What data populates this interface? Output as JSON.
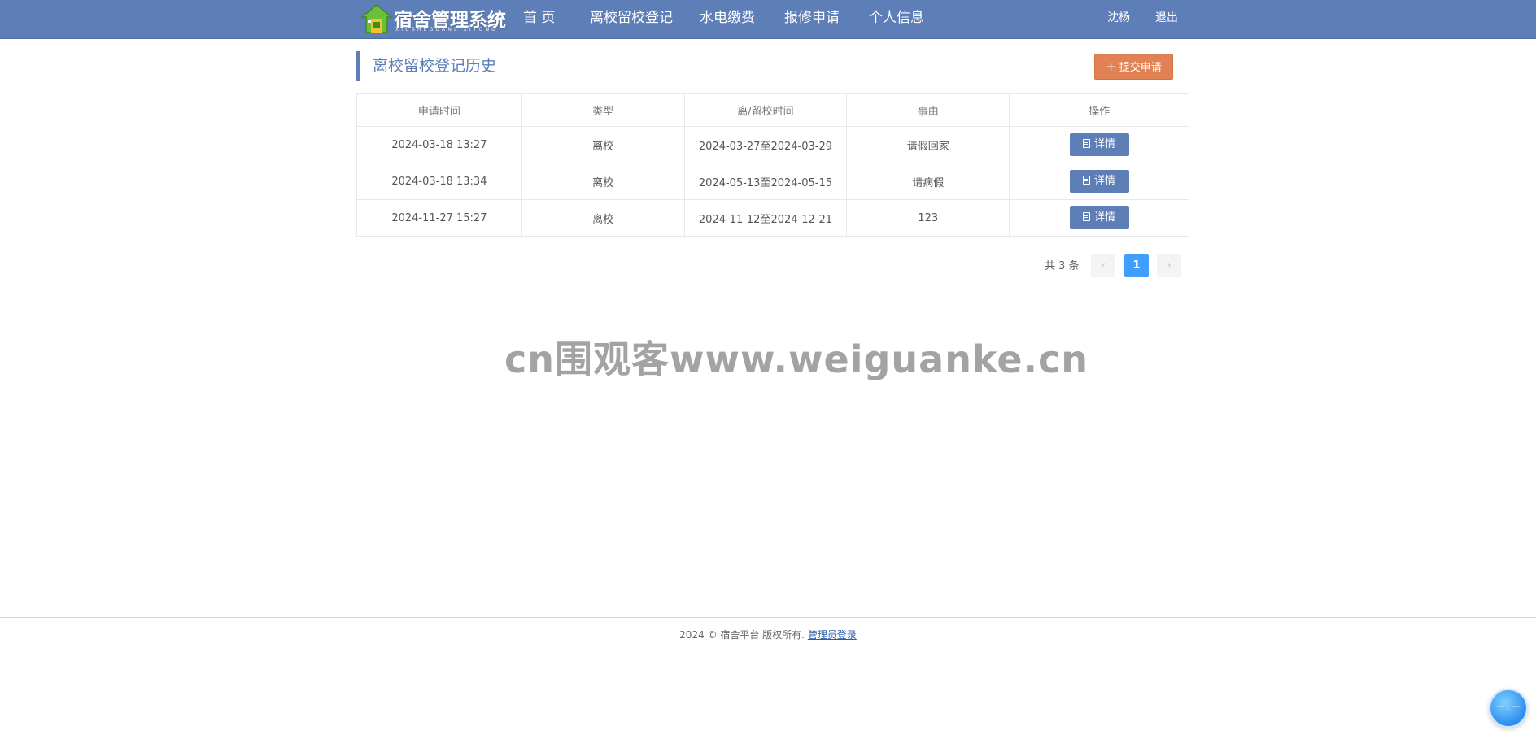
{
  "app": {
    "logo_title": "宿舍管理系统",
    "logo_subtitle": "XIUSHEGUANLIXITONG"
  },
  "nav": {
    "items": [
      {
        "label": "首 页"
      },
      {
        "label": "离校留校登记"
      },
      {
        "label": "水电缴费"
      },
      {
        "label": "报修申请"
      },
      {
        "label": "个人信息"
      }
    ],
    "user_name": "沈杨",
    "logout_label": "退出"
  },
  "page": {
    "title": "离校留校登记历史",
    "submit_label": "提交申请",
    "submit_icon": "plus-icon"
  },
  "table": {
    "columns": [
      "申请时间",
      "类型",
      "离/留校时间",
      "事由",
      "操作"
    ],
    "rows": [
      {
        "apply_time": "2024-03-18 13:27",
        "type": "离校",
        "period": "2024-03-27至2024-03-29",
        "reason": "请假回家",
        "action": "详情"
      },
      {
        "apply_time": "2024-03-18 13:34",
        "type": "离校",
        "period": "2024-05-13至2024-05-15",
        "reason": "请病假",
        "action": "详情"
      },
      {
        "apply_time": "2024-11-27 15:27",
        "type": "离校",
        "period": "2024-11-12至2024-12-21",
        "reason": "123",
        "action": "详情"
      }
    ],
    "action_icon": "document-icon"
  },
  "pagination": {
    "total_text": "共 3 条",
    "prev": "‹",
    "next": "›",
    "current_page": "1"
  },
  "watermark": "cn围观客www.weiguanke.cn",
  "footer": {
    "copyright": "2024 © 宿舍平台 版权所有.",
    "admin_login": "管理员登录"
  },
  "widget": {
    "label": "一 : 一"
  },
  "colors": {
    "nav_bg": "#5d7eb6",
    "accent_orange": "#e18254",
    "pager_active": "#409eff"
  }
}
